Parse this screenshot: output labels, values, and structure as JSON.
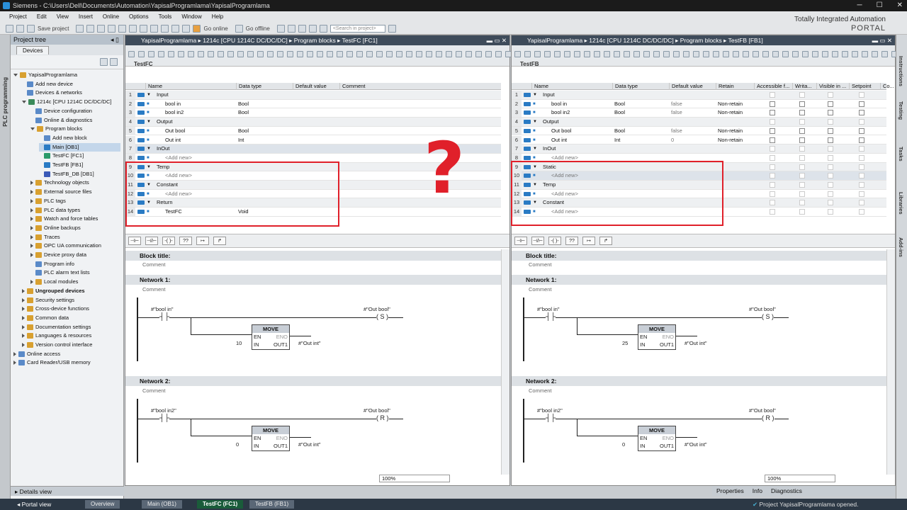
{
  "title": "Siemens  -  C:\\Users\\Dell\\Documents\\Automation\\YapisalProgramlama\\YapisalProgramlama",
  "menu": [
    "Project",
    "Edit",
    "View",
    "Insert",
    "Online",
    "Options",
    "Tools",
    "Window",
    "Help"
  ],
  "toolbar": {
    "save_project": "Save project",
    "go_online": "Go online",
    "go_offline": "Go offline",
    "search_placeholder": "<Search in project>"
  },
  "branding": {
    "line1": "Totally Integrated Automation",
    "line2": "PORTAL"
  },
  "left_strip": "PLC programming",
  "project_tree": {
    "header": "Project tree",
    "tab": "Devices",
    "items": [
      {
        "label": "YapisalProgramlama",
        "indent": 0,
        "exp": "open",
        "color": "#d8a030"
      },
      {
        "label": "Add new device",
        "indent": 1,
        "color": "#5a8ac8"
      },
      {
        "label": "Devices & networks",
        "indent": 1,
        "color": "#5a8ac8"
      },
      {
        "label": "1214c [CPU 1214C DC/DC/DC]",
        "indent": 1,
        "exp": "open",
        "color": "#3a8a5a"
      },
      {
        "label": "Device configuration",
        "indent": 2,
        "color": "#5a8ac8"
      },
      {
        "label": "Online & diagnostics",
        "indent": 2,
        "color": "#5a8ac8"
      },
      {
        "label": "Program blocks",
        "indent": 2,
        "exp": "open",
        "color": "#d8a030"
      },
      {
        "label": "Add new block",
        "indent": 3,
        "color": "#5a8ac8"
      },
      {
        "label": "Main [OB1]",
        "indent": 3,
        "color": "#2a7bc4",
        "sel": true
      },
      {
        "label": "TestFC [FC1]",
        "indent": 3,
        "color": "#2a9a6a"
      },
      {
        "label": "TestFB [FB1]",
        "indent": 3,
        "color": "#2a7bc4"
      },
      {
        "label": "TestFB_DB [DB1]",
        "indent": 3,
        "color": "#3a5ab8"
      },
      {
        "label": "Technology objects",
        "indent": 2,
        "exp": "closed",
        "color": "#d8a030"
      },
      {
        "label": "External source files",
        "indent": 2,
        "exp": "closed",
        "color": "#d8a030"
      },
      {
        "label": "PLC tags",
        "indent": 2,
        "exp": "closed",
        "color": "#d8a030"
      },
      {
        "label": "PLC data types",
        "indent": 2,
        "exp": "closed",
        "color": "#d8a030"
      },
      {
        "label": "Watch and force tables",
        "indent": 2,
        "exp": "closed",
        "color": "#d8a030"
      },
      {
        "label": "Online backups",
        "indent": 2,
        "exp": "closed",
        "color": "#d8a030"
      },
      {
        "label": "Traces",
        "indent": 2,
        "exp": "closed",
        "color": "#d8a030"
      },
      {
        "label": "OPC UA communication",
        "indent": 2,
        "exp": "closed",
        "color": "#d8a030"
      },
      {
        "label": "Device proxy data",
        "indent": 2,
        "exp": "closed",
        "color": "#d8a030"
      },
      {
        "label": "Program info",
        "indent": 2,
        "color": "#5a8ac8"
      },
      {
        "label": "PLC alarm text lists",
        "indent": 2,
        "color": "#5a8ac8"
      },
      {
        "label": "Local modules",
        "indent": 2,
        "exp": "closed",
        "color": "#d8a030"
      },
      {
        "label": "Ungrouped devices",
        "indent": 1,
        "exp": "closed",
        "color": "#d8a030"
      },
      {
        "label": "Security settings",
        "indent": 1,
        "exp": "closed",
        "color": "#d8a030"
      },
      {
        "label": "Cross-device functions",
        "indent": 1,
        "exp": "closed",
        "color": "#d8a030"
      },
      {
        "label": "Common data",
        "indent": 1,
        "exp": "closed",
        "color": "#d8a030"
      },
      {
        "label": "Documentation settings",
        "indent": 1,
        "exp": "closed",
        "color": "#d8a030"
      },
      {
        "label": "Languages & resources",
        "indent": 1,
        "exp": "closed",
        "color": "#d8a030"
      },
      {
        "label": "Version control interface",
        "indent": 1,
        "exp": "closed",
        "color": "#d8a030"
      },
      {
        "label": "Online access",
        "indent": 0,
        "exp": "closed",
        "color": "#5a8ac8"
      },
      {
        "label": "Card Reader/USB memory",
        "indent": 0,
        "exp": "closed",
        "color": "#5a8ac8"
      }
    ],
    "details_view": "Details view"
  },
  "fc_editor": {
    "breadcrumb": "YapisalProgramlama  ▸  1214c [CPU 1214C DC/DC/DC]  ▸  Program blocks  ▸  TestFC [FC1]",
    "block_name": "TestFC",
    "headers": [
      "Name",
      "Data type",
      "Default value",
      "Comment"
    ],
    "rows": [
      {
        "n": "1",
        "name": "Input",
        "type": "",
        "group": true
      },
      {
        "n": "2",
        "name": "bool in",
        "type": "Bool"
      },
      {
        "n": "3",
        "name": "bool in2",
        "type": "Bool"
      },
      {
        "n": "4",
        "name": "Output",
        "type": "",
        "group": true
      },
      {
        "n": "5",
        "name": "Out bool",
        "type": "Bool"
      },
      {
        "n": "6",
        "name": "Out int",
        "type": "Int"
      },
      {
        "n": "7",
        "name": "InOut",
        "type": "",
        "group": true,
        "hl": true
      },
      {
        "n": "8",
        "name": "<Add new>",
        "type": "",
        "add": true
      },
      {
        "n": "9",
        "name": "Temp",
        "type": "",
        "group": true
      },
      {
        "n": "10",
        "name": "<Add new>",
        "type": "",
        "add": true
      },
      {
        "n": "11",
        "name": "Constant",
        "type": "",
        "group": true
      },
      {
        "n": "12",
        "name": "<Add new>",
        "type": "",
        "add": true
      },
      {
        "n": "13",
        "name": "Return",
        "type": "",
        "group": true
      },
      {
        "n": "14",
        "name": "TestFC",
        "type": "Void"
      }
    ],
    "block_title": "Block title:",
    "comment": "Comment",
    "network1": "Network 1:",
    "network2": "Network 2:",
    "n1_contact": "#\"bool in\"",
    "n1_coil": "#\"Out bool\"",
    "n1_coil_type": "S",
    "n1_move_in": "10",
    "n2_contact": "#\"bool in2\"",
    "n2_coil": "#\"Out bool\"",
    "n2_coil_type": "R",
    "n2_move_in": "0",
    "move": "MOVE",
    "en": "EN",
    "eno": "ENO",
    "in": "IN",
    "out1": "OUT1",
    "out_tag": "#\"Out int\"",
    "zoom": "100%"
  },
  "fb_editor": {
    "breadcrumb": "YapisalProgramlama  ▸  1214c [CPU 1214C DC/DC/DC]  ▸  Program blocks  ▸  TestFB [FB1]",
    "block_name": "TestFB",
    "headers": [
      "Name",
      "Data type",
      "Default value",
      "Retain",
      "Accessible f...",
      "Writa...",
      "Visible in ...",
      "Setpoint",
      "Co..."
    ],
    "rows": [
      {
        "n": "1",
        "name": "Input",
        "type": "",
        "def": "",
        "ret": "",
        "group": true
      },
      {
        "n": "2",
        "name": "bool in",
        "type": "Bool",
        "def": "false",
        "ret": "Non-retain"
      },
      {
        "n": "3",
        "name": "bool in2",
        "type": "Bool",
        "def": "false",
        "ret": "Non-retain"
      },
      {
        "n": "4",
        "name": "Output",
        "type": "",
        "def": "",
        "ret": "",
        "group": true
      },
      {
        "n": "5",
        "name": "Out bool",
        "type": "Bool",
        "def": "false",
        "ret": "Non-retain"
      },
      {
        "n": "6",
        "name": "Out int",
        "type": "Int",
        "def": "0",
        "ret": "Non-retain"
      },
      {
        "n": "7",
        "name": "InOut",
        "type": "",
        "def": "",
        "ret": "",
        "group": true
      },
      {
        "n": "8",
        "name": "<Add new>",
        "type": "",
        "def": "",
        "ret": "",
        "add": true
      },
      {
        "n": "9",
        "name": "Static",
        "type": "",
        "def": "",
        "ret": "",
        "group": true
      },
      {
        "n": "10",
        "name": "<Add new>",
        "type": "",
        "def": "",
        "ret": "",
        "add": true,
        "hl": true
      },
      {
        "n": "11",
        "name": "Temp",
        "type": "",
        "def": "",
        "ret": "",
        "group": true
      },
      {
        "n": "12",
        "name": "<Add new>",
        "type": "",
        "def": "",
        "ret": "",
        "add": true
      },
      {
        "n": "13",
        "name": "Constant",
        "type": "",
        "def": "",
        "ret": "",
        "group": true
      },
      {
        "n": "14",
        "name": "<Add new>",
        "type": "",
        "def": "",
        "ret": "",
        "add": true
      }
    ],
    "block_title": "Block title:",
    "comment": "Comment",
    "network1": "Network 1:",
    "network2": "Network 2:",
    "n1_contact": "#\"bool in\"",
    "n1_coil": "#\"Out bool\"",
    "n1_coil_type": "S",
    "n1_move_in": "25",
    "n2_contact": "#\"bool in2\"",
    "n2_coil": "#\"Out bool\"",
    "n2_coil_type": "R",
    "n2_move_in": "0",
    "move": "MOVE",
    "en": "EN",
    "eno": "ENO",
    "in": "IN",
    "out1": "OUT1",
    "out_tag": "#\"Out int\"",
    "zoom": "100%"
  },
  "annotation": "?",
  "right_tabs": [
    "Instructions",
    "Testing",
    "Tasks",
    "Libraries",
    "Add-ins"
  ],
  "bottom": {
    "properties": "Properties",
    "info": "Info",
    "diagnostics": "Diagnostics",
    "portal_view": "Portal view",
    "tabs": [
      "Overview",
      "Main (OB1)",
      "TestFC (FC1)",
      "TestFB (FB1)"
    ],
    "status": "Project YapisalProgramlama opened."
  },
  "colors": {
    "accent_red": "#e0202a",
    "header_dark": "#3e4b5a",
    "portal_bar": "#2c3845"
  }
}
